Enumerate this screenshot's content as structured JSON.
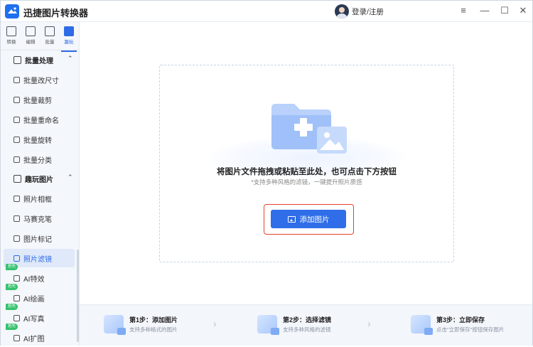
{
  "app": {
    "title": "迅捷图片转换器",
    "brand_color": "#1f6ff0",
    "accent_color": "#2f6ee8",
    "highlight_border_color": "#e2452b"
  },
  "titlebar": {
    "login_label": "登录/注册",
    "controls": {
      "menu_icon": "hamburger-icon",
      "minimize_icon": "minimize-icon",
      "maximize_icon": "maximize-icon",
      "close_icon": "close-icon",
      "menu": "≡",
      "minimize": "—",
      "maximize": "☐",
      "close": "✕"
    }
  },
  "sidebar": {
    "tabs": [
      {
        "label": "转换",
        "icon": "convert-icon",
        "active": false
      },
      {
        "label": "编辑",
        "icon": "edit-icon",
        "active": false
      },
      {
        "label": "批量",
        "icon": "batch-icon",
        "active": false
      },
      {
        "label": "趣玩",
        "icon": "fun-icon",
        "active": true
      }
    ],
    "groups": [
      {
        "label": "批量处理",
        "icon": "batch-process-icon",
        "items": [
          {
            "label": "批量改尺寸",
            "icon": "resize-icon"
          },
          {
            "label": "批量裁剪",
            "icon": "crop-icon"
          },
          {
            "label": "批量重命名",
            "icon": "rename-icon"
          },
          {
            "label": "批量旋转",
            "icon": "rotate-icon"
          },
          {
            "label": "批量分类",
            "icon": "classify-icon"
          }
        ]
      },
      {
        "label": "趣玩图片",
        "icon": "fun-image-icon",
        "items": [
          {
            "label": "照片相框",
            "icon": "frame-icon"
          },
          {
            "label": "马赛克笔",
            "icon": "mosaic-icon"
          },
          {
            "label": "图片标记",
            "icon": "mark-icon"
          },
          {
            "label": "照片滤镜",
            "icon": "filter-icon",
            "active": true
          },
          {
            "label": "AI特效",
            "icon": "ai-effect-icon",
            "badge": "抢先"
          },
          {
            "label": "AI绘画",
            "icon": "ai-paint-icon",
            "badge": "抢先"
          },
          {
            "label": "AI写真",
            "icon": "ai-portrait-icon",
            "badge": "抢先"
          },
          {
            "label": "AI扩图",
            "icon": "ai-expand-icon",
            "badge": "抢先"
          }
        ]
      }
    ]
  },
  "main": {
    "drop_title": "将图片文件拖拽或粘贴至此处，也可点击下方按钮",
    "drop_hint": "*支持多种风格的滤镜，一键提升照片质感",
    "add_button_label": "添加图片",
    "steps": [
      {
        "title": "第1步：添加图片",
        "desc": "支持多种格式的图片"
      },
      {
        "title": "第2步：选择滤镜",
        "desc": "支持多种风格的滤镜"
      },
      {
        "title": "第3步：立即保存",
        "desc": "点击\"立即保存\"按钮保存图片"
      }
    ]
  }
}
